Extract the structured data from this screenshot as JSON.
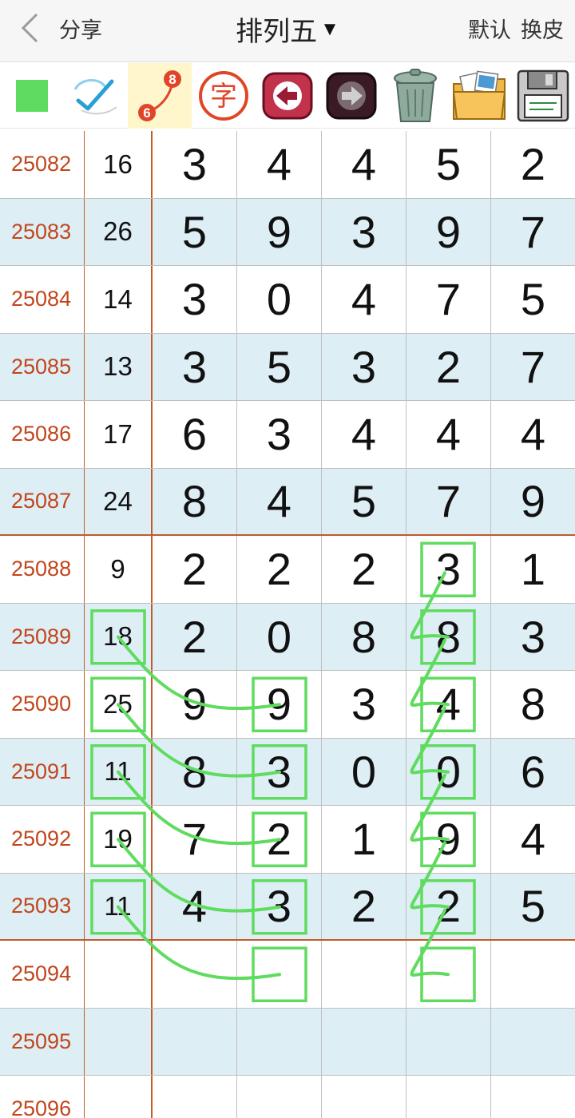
{
  "header": {
    "back_label": "分享",
    "title": "排列五",
    "title_caret": "▼",
    "default_label": "默认",
    "skin_label": "换皮"
  },
  "toolbar": {
    "items": [
      {
        "icon": "green-square-icon",
        "color": "#5fdc5f"
      },
      {
        "icon": "pen-check-icon"
      },
      {
        "icon": "connect-numbers-icon",
        "badge_top": "8",
        "badge_bottom": "6"
      },
      {
        "icon": "character-stamp-icon",
        "text": "字"
      },
      {
        "icon": "undo-arrow-icon"
      },
      {
        "icon": "redo-arrow-icon"
      },
      {
        "icon": "trash-can-icon"
      },
      {
        "icon": "photo-folder-icon"
      },
      {
        "icon": "floppy-disk-icon"
      }
    ]
  },
  "colors": {
    "issue_text": "#c2451b",
    "group_line": "#c25a2a",
    "row_alt": "#deeef5",
    "marker": "#5fdc5f",
    "active_tool": "#fff6cc"
  },
  "table": {
    "rows": [
      {
        "issue": "25082",
        "sum": "16",
        "digits": [
          "3",
          "4",
          "4",
          "5",
          "2"
        ]
      },
      {
        "issue": "25083",
        "sum": "26",
        "digits": [
          "5",
          "9",
          "3",
          "9",
          "7"
        ]
      },
      {
        "issue": "25084",
        "sum": "14",
        "digits": [
          "3",
          "0",
          "4",
          "7",
          "5"
        ]
      },
      {
        "issue": "25085",
        "sum": "13",
        "digits": [
          "3",
          "5",
          "3",
          "2",
          "7"
        ]
      },
      {
        "issue": "25086",
        "sum": "17",
        "digits": [
          "6",
          "3",
          "4",
          "4",
          "4"
        ]
      },
      {
        "issue": "25087",
        "sum": "24",
        "digits": [
          "8",
          "4",
          "5",
          "7",
          "9"
        ]
      },
      {
        "issue": "25088",
        "sum": "9",
        "digits": [
          "2",
          "2",
          "2",
          "3",
          "1"
        ]
      },
      {
        "issue": "25089",
        "sum": "18",
        "digits": [
          "2",
          "0",
          "8",
          "8",
          "3"
        ]
      },
      {
        "issue": "25090",
        "sum": "25",
        "digits": [
          "9",
          "9",
          "3",
          "4",
          "8"
        ]
      },
      {
        "issue": "25091",
        "sum": "11",
        "digits": [
          "8",
          "3",
          "0",
          "0",
          "6"
        ]
      },
      {
        "issue": "25092",
        "sum": "19",
        "digits": [
          "7",
          "2",
          "1",
          "9",
          "4"
        ]
      },
      {
        "issue": "25093",
        "sum": "11",
        "digits": [
          "4",
          "3",
          "2",
          "2",
          "5"
        ]
      },
      {
        "issue": "25094",
        "sum": "",
        "digits": [
          "",
          "",
          "",
          "",
          ""
        ]
      },
      {
        "issue": "25095",
        "sum": "",
        "digits": [
          "",
          "",
          "",
          "",
          ""
        ]
      },
      {
        "issue": "25096",
        "sum": "",
        "digits": [
          "",
          "",
          "",
          "",
          ""
        ]
      }
    ]
  }
}
